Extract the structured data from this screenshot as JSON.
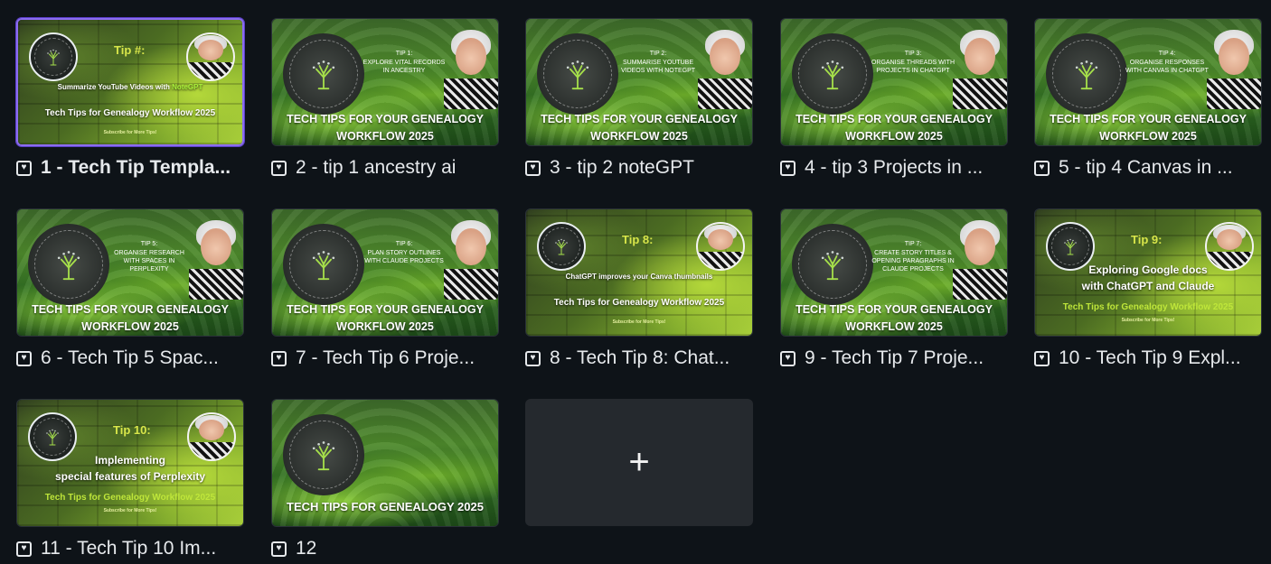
{
  "designs": [
    {
      "title": "1 - Tech Tip Templa...",
      "selected": true,
      "style": "moss",
      "thumb": {
        "tip": "Tip #:",
        "headline": "Summarize YouTube Videos with ",
        "headline_accent": "NoteGPT",
        "banner": "Tech Tips for Genealogy Workflow 2025",
        "sub": "Subscribe for More Tips!"
      }
    },
    {
      "title": "2 - tip 1 ancestry ai",
      "style": "hills",
      "thumb": {
        "tip": "TIP 1:",
        "tip_text": "EXPLORE VITAL RECORDS IN ANCESTRY",
        "banner_line1": "TECH TIPS FOR YOUR GENEALOGY",
        "banner_line2": "WORKFLOW 2025"
      }
    },
    {
      "title": "3 - tip 2 noteGPT",
      "style": "hills",
      "thumb": {
        "tip": "TIP 2:",
        "tip_text": "SUMMARISE YOUTUBE VIDEOS WITH NoteGPT",
        "banner_line1": "TECH TIPS FOR YOUR GENEALOGY",
        "banner_line2": "WORKFLOW 2025"
      }
    },
    {
      "title": "4 - tip 3 Projects in ...",
      "style": "hills",
      "thumb": {
        "tip": "TIP 3:",
        "tip_text": "ORGANISE THREADS WITH PROJECTS IN CHATGPT",
        "banner_line1": "TECH TIPS FOR YOUR GENEALOGY",
        "banner_line2": "WORKFLOW 2025"
      }
    },
    {
      "title": "5 - tip 4 Canvas in ...",
      "style": "hills",
      "thumb": {
        "tip": "TIP 4:",
        "tip_text": "ORGANISE RESPONSES WITH CANVAS IN CHATGPT",
        "banner_line1": "TECH TIPS FOR YOUR GENEALOGY",
        "banner_line2": "WORKFLOW 2025"
      }
    },
    {
      "title": "6 - Tech Tip 5 Spac...",
      "style": "hills",
      "thumb": {
        "tip": "TIP 5:",
        "tip_text": "ORGANISE RESEARCH WITH SPACES IN PERPLEXITY",
        "banner_line1": "TECH TIPS FOR YOUR GENEALOGY",
        "banner_line2": "WORKFLOW 2025"
      }
    },
    {
      "title": "7 - Tech Tip 6 Proje...",
      "style": "hills",
      "thumb": {
        "tip": "TIP 6:",
        "tip_text": "PLAN STORY OUTLINES WITH CLAUDE PROJECTS",
        "banner_line1": "TECH TIPS FOR YOUR GENEALOGY",
        "banner_line2": "WORKFLOW 2025"
      }
    },
    {
      "title": "8 - Tech Tip 8: Chat...",
      "style": "moss",
      "thumb": {
        "tip": "Tip 8:",
        "headline": "ChatGPT improves your Canva thumbnails",
        "headline_accent": "",
        "banner": "Tech Tips for Genealogy Workflow 2025",
        "sub": "Subscribe for More Tips!"
      }
    },
    {
      "title": "9 - Tech Tip 7 Proje...",
      "style": "hills",
      "thumb": {
        "tip": "TIP 7:",
        "tip_text": "CREATE STORY TITLES & OPENING PARAGRAPHS IN CLAUDE PROJECTS",
        "banner_line1": "TECH TIPS FOR YOUR GENEALOGY",
        "banner_line2": "WORKFLOW 2025"
      }
    },
    {
      "title": "10 - Tech Tip 9 Expl...",
      "style": "moss-big",
      "thumb": {
        "tip": "Tip 9:",
        "headline_line1": "Exploring Google docs",
        "headline_line2": "with ChatGPT and Claude",
        "banner": "Tech Tips for Genealogy Workflow 2025",
        "sub": "Subscribe for More Tips!"
      }
    },
    {
      "title": "11 - Tech Tip 10 Im...",
      "style": "moss-big",
      "thumb": {
        "tip": "Tip 10:",
        "headline_line1": "Implementing",
        "headline_line2": "special features of Perplexity",
        "banner": "Tech Tips for Genealogy Workflow 2025",
        "sub": "Subscribe for More Tips!"
      }
    },
    {
      "title": "12",
      "style": "hills-plain",
      "thumb": {
        "banner": "TECH TIPS FOR GENEALOGY 2025"
      }
    }
  ],
  "add_tile": {
    "label": "+"
  }
}
